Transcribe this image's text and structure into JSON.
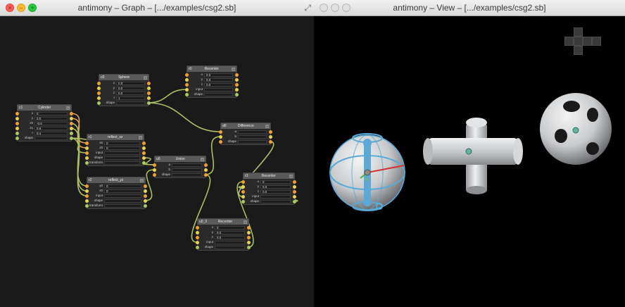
{
  "graph_window": {
    "title": "antimony – Graph – [.../examples/csg2.sb]",
    "traffic_lights": [
      "close-icon",
      "minimize-icon",
      "zoom-icon"
    ],
    "resize_icon": "fullscreen-icon",
    "nodes": [
      {
        "id": "c0",
        "title": "Sphere",
        "rows": [
          {
            "label": "x",
            "value": "0.0"
          },
          {
            "label": "y",
            "value": "0.0"
          },
          {
            "label": "z",
            "value": "0.0"
          },
          {
            "label": "r",
            "value": "1"
          },
          {
            "label": "shape",
            "value": ""
          }
        ]
      },
      {
        "id": "r0",
        "title": "Recenter",
        "rows": [
          {
            "label": "x",
            "value": "0.0"
          },
          {
            "label": "y",
            "value": "0.0"
          },
          {
            "label": "z",
            "value": "0.0"
          },
          {
            "label": "input",
            "value": ""
          },
          {
            "label": "shape",
            "value": ""
          }
        ]
      },
      {
        "id": "c1",
        "title": "Cylinder",
        "rows": [
          {
            "label": "x",
            "value": "0"
          },
          {
            "label": "y",
            "value": "0.0"
          },
          {
            "label": "z0",
            "value": "-0.6"
          },
          {
            "label": "z1",
            "value": "0.6"
          },
          {
            "label": "r",
            "value": "0.4"
          },
          {
            "label": "shape",
            "value": ""
          }
        ]
      },
      {
        "id": "d0",
        "title": "Difference",
        "rows": [
          {
            "label": "a",
            "value": ""
          },
          {
            "label": "b",
            "value": ""
          },
          {
            "label": "shape",
            "value": ""
          }
        ]
      },
      {
        "id": "r1",
        "title": "reflect_xz",
        "rows": [
          {
            "label": "x0",
            "value": "0"
          },
          {
            "label": "z0",
            "value": "0"
          },
          {
            "label": "input",
            "value": ""
          },
          {
            "label": "shape",
            "value": ""
          },
          {
            "label": "transform",
            "value": ""
          }
        ]
      },
      {
        "id": "u0",
        "title": "Union",
        "rows": [
          {
            "label": "a",
            "value": ""
          },
          {
            "label": "b",
            "value": ""
          },
          {
            "label": "shape",
            "value": ""
          }
        ]
      },
      {
        "id": "r2",
        "title": "reflect_yz",
        "rows": [
          {
            "label": "y0",
            "value": "0"
          },
          {
            "label": "z0",
            "value": "0"
          },
          {
            "label": "input",
            "value": ""
          },
          {
            "label": "shape",
            "value": ""
          },
          {
            "label": "transform",
            "value": ""
          }
        ]
      },
      {
        "id": "r3",
        "title": "Recenter",
        "rows": [
          {
            "label": "x",
            "value": "0"
          },
          {
            "label": "y",
            "value": "0.0"
          },
          {
            "label": "z",
            "value": "0.0"
          },
          {
            "label": "input",
            "value": ""
          },
          {
            "label": "shape",
            "value": ""
          }
        ]
      },
      {
        "id": "u0_0",
        "title": "Recenter",
        "rows": [
          {
            "label": "x",
            "value": "0"
          },
          {
            "label": "y",
            "value": "0.0"
          },
          {
            "label": "z",
            "value": "0.0"
          },
          {
            "label": "input",
            "value": ""
          },
          {
            "label": "shape",
            "value": ""
          }
        ]
      }
    ]
  },
  "view_window": {
    "title": "antimony – View – [.../examples/csg2.sb]",
    "traffic_lights": [
      "close-icon",
      "minimize-icon",
      "zoom-icon"
    ],
    "navigation_cube": "view-cube-icon",
    "objects": [
      "sphere-with-handles",
      "cylinder-cross",
      "sphere-with-holes"
    ]
  },
  "colors": {
    "wire": "#a8c060",
    "port_orange": "#f0a030",
    "port_yellow": "#e8d050",
    "port_green": "#a8c860",
    "handle_blue": "#5aa9d6",
    "gizmo_red": "#d83030",
    "gizmo_green": "#40b040",
    "shape_grey": "#d8dadc"
  }
}
